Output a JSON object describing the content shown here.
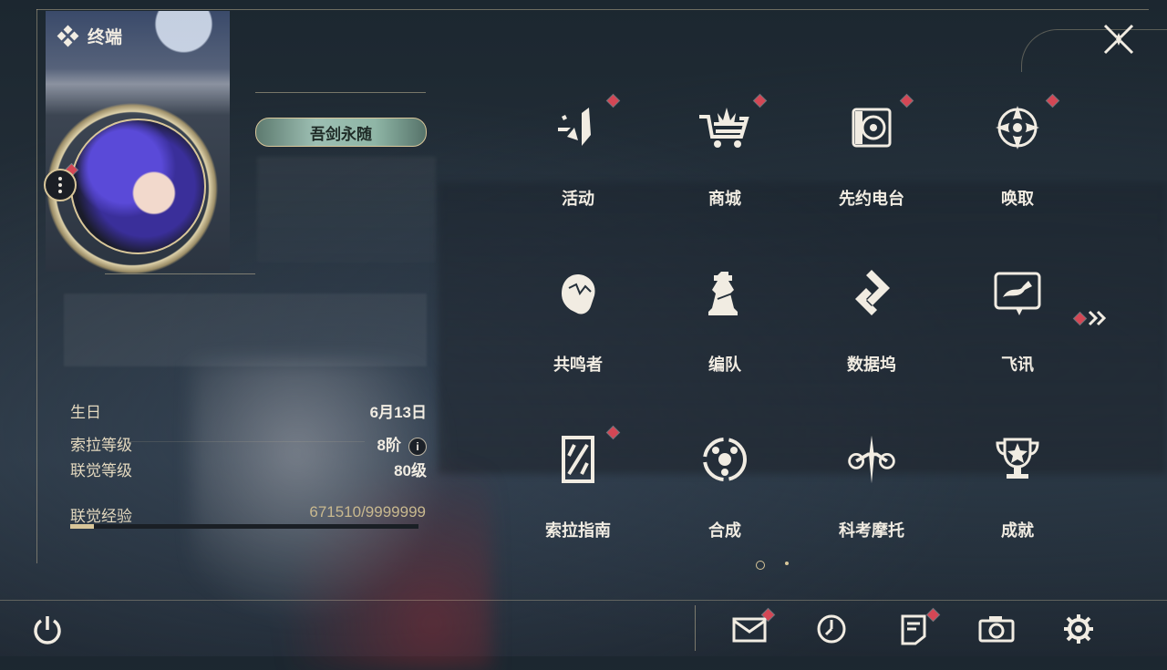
{
  "header": {
    "title": "终端"
  },
  "profile": {
    "title_badge": "吾剑永随",
    "stats": {
      "birthday_label": "生日",
      "birthday_value": "6月13日",
      "sola_level_label": "索拉等级",
      "sola_level_value": "8阶",
      "union_level_label": "联觉等级",
      "union_level_value": "80级",
      "union_exp_label": "联觉经验",
      "union_exp_value": "671510/9999999",
      "union_exp_fraction": 0.067
    }
  },
  "menu": {
    "items": [
      {
        "label": "活动",
        "icon": "activity-icon",
        "badge": true
      },
      {
        "label": "商城",
        "icon": "shop-cart-icon",
        "badge": true
      },
      {
        "label": "先约电台",
        "icon": "radio-icon",
        "badge": true
      },
      {
        "label": "唤取",
        "icon": "summon-compass-icon",
        "badge": true
      },
      {
        "label": "共鸣者",
        "icon": "resonator-head-icon",
        "badge": false
      },
      {
        "label": "编队",
        "icon": "team-chess-icon",
        "badge": false
      },
      {
        "label": "数据坞",
        "icon": "data-dock-icon",
        "badge": false
      },
      {
        "label": "飞讯",
        "icon": "message-chat-icon",
        "badge": false
      },
      {
        "label": "索拉指南",
        "icon": "guide-book-icon",
        "badge": true
      },
      {
        "label": "合成",
        "icon": "synthesis-icon",
        "badge": false
      },
      {
        "label": "科考摩托",
        "icon": "motorcycle-icon",
        "badge": false
      },
      {
        "label": "成就",
        "icon": "trophy-icon",
        "badge": false
      }
    ]
  },
  "pagination": {
    "current": 1,
    "total": 2
  },
  "bottom_bar": {
    "icons": [
      "power-icon",
      "mail-icon",
      "clock-icon",
      "notice-icon",
      "camera-icon",
      "settings-gear-icon"
    ]
  },
  "colors": {
    "accent_gold": "#d9c79a",
    "badge_red": "#d44755",
    "text_light": "#f1ece2"
  }
}
